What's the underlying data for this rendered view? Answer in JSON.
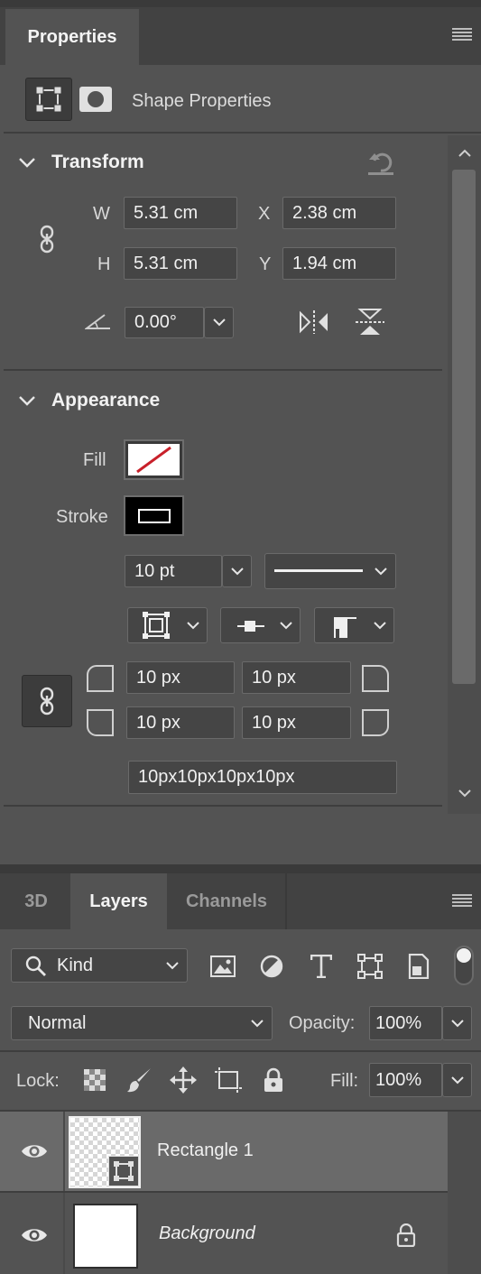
{
  "properties_panel": {
    "tab_label": "Properties",
    "subtitle": "Shape Properties",
    "transform": {
      "title": "Transform",
      "w_label": "W",
      "w_value": "5.31 cm",
      "x_label": "X",
      "x_value": "2.38 cm",
      "h_label": "H",
      "h_value": "5.31 cm",
      "y_label": "Y",
      "y_value": "1.94 cm",
      "angle_value": "0.00°"
    },
    "appearance": {
      "title": "Appearance",
      "fill_label": "Fill",
      "stroke_label": "Stroke",
      "stroke_width": "10 pt",
      "corner_tl": "10 px",
      "corner_tr": "10 px",
      "corner_bl": "10 px",
      "corner_br": "10 px",
      "corners_combined": "10px10px10px10px"
    }
  },
  "layers_panel": {
    "tabs": [
      {
        "label": "3D"
      },
      {
        "label": "Layers"
      },
      {
        "label": "Channels"
      }
    ],
    "filter_kind": "Kind",
    "blend_mode": "Normal",
    "opacity_label": "Opacity:",
    "opacity_value": "100%",
    "lock_label": "Lock:",
    "fill_label": "Fill:",
    "fill_value": "100%",
    "layers": [
      {
        "name": "Rectangle 1"
      },
      {
        "name": "Background"
      }
    ]
  },
  "colors": {
    "panel_bg": "#535353",
    "header_bg": "#424242",
    "field_bg": "#454545",
    "selected_row": "#6a6a6a",
    "fill_slash": "#c8202a"
  }
}
